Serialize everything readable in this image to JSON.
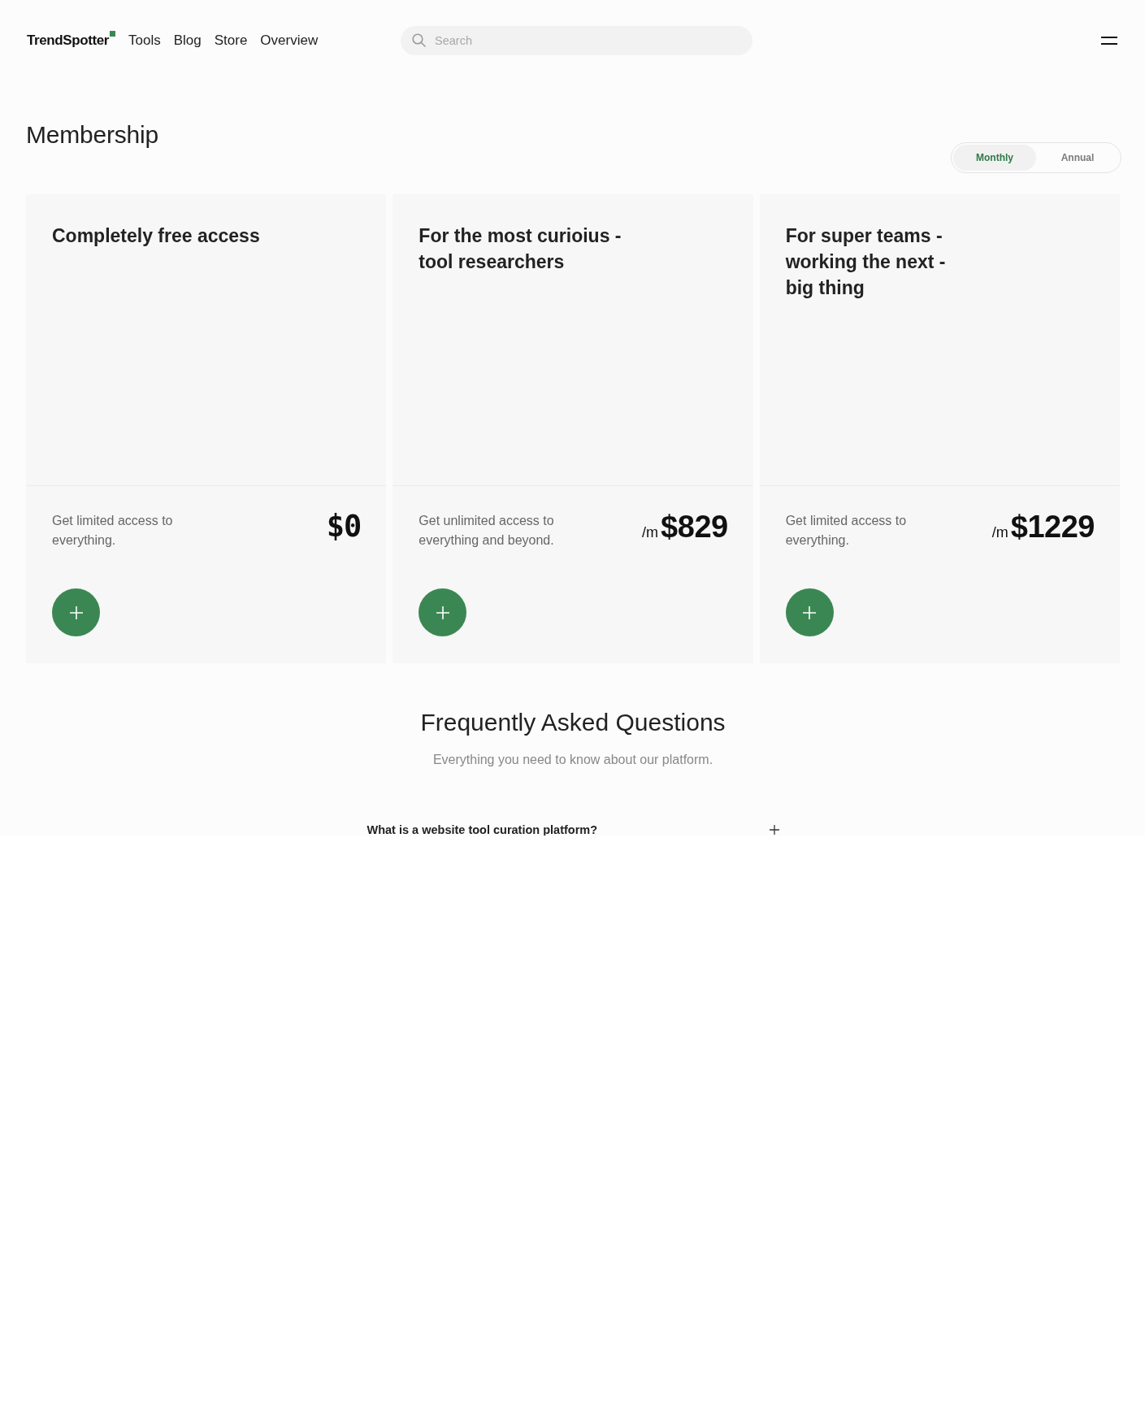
{
  "header": {
    "logo": "TrendSpotter",
    "nav": [
      "Tools",
      "Blog",
      "Store",
      "Overview"
    ],
    "search": {
      "placeholder": "Search"
    }
  },
  "membership": {
    "title": "Membership",
    "billing_toggle": [
      {
        "label": "Monthly",
        "selected": true
      },
      {
        "label": "Annual",
        "selected": false
      }
    ],
    "plans": [
      {
        "kind": "free",
        "title_lines": [
          "Completely free access"
        ],
        "description": "Get limited access to everything.",
        "price": "$0"
      },
      {
        "kind": "paid",
        "title_lines": [
          "For the most curioius -",
          "tool researchers"
        ],
        "description": "Get unlimited access to everything and beyond.",
        "period": "/m",
        "price": "$829"
      },
      {
        "kind": "paid",
        "title_lines": [
          "For super teams -",
          "working the next -",
          "big thing"
        ],
        "description": "Get limited access to everything.",
        "period": "/m",
        "price": "$1229"
      }
    ]
  },
  "faq": {
    "title": "Frequently Asked Questions",
    "subtitle": "Everything you need to know about our platform.",
    "items": [
      {
        "question": "What is a website tool curation platform?",
        "expanded": false
      }
    ]
  }
}
